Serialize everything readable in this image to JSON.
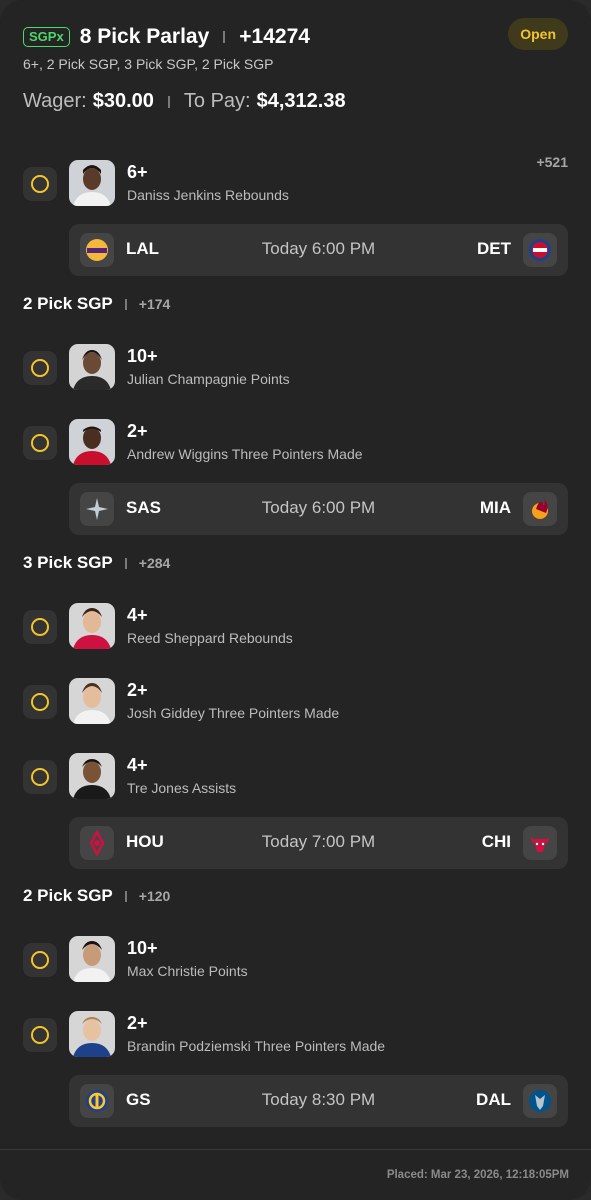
{
  "header": {
    "badge": "SGPx",
    "title": "8 Pick Parlay",
    "odds": "+14274",
    "subtitle": "6+, 2 Pick SGP, 3 Pick SGP, 2 Pick SGP",
    "status": "Open"
  },
  "wager": {
    "wager_label": "Wager:",
    "wager_value": "$30.00",
    "pay_label": "To Pay:",
    "pay_value": "$4,312.38"
  },
  "legs": [
    {
      "line": "6+",
      "desc": "Daniss Jenkins Rebounds",
      "odds": "+521"
    },
    {
      "line": "10+",
      "desc": "Julian Champagnie Points"
    },
    {
      "line": "2+",
      "desc": "Andrew Wiggins Three Pointers Made"
    },
    {
      "line": "4+",
      "desc": "Reed Sheppard Rebounds"
    },
    {
      "line": "2+",
      "desc": "Josh Giddey Three Pointers Made"
    },
    {
      "line": "4+",
      "desc": "Tre Jones Assists"
    },
    {
      "line": "10+",
      "desc": "Max Christie Points"
    },
    {
      "line": "2+",
      "desc": "Brandin Podziemski Three Pointers Made"
    }
  ],
  "groups": [
    {
      "title": "2 Pick SGP",
      "odds": "+174"
    },
    {
      "title": "3 Pick SGP",
      "odds": "+284"
    },
    {
      "title": "2 Pick SGP",
      "odds": "+120"
    }
  ],
  "games": [
    {
      "away": "LAL",
      "home": "DET",
      "time": "Today 6:00 PM",
      "away_icon": "lakers-logo-icon",
      "home_icon": "pistons-logo-icon"
    },
    {
      "away": "SAS",
      "home": "MIA",
      "time": "Today 6:00 PM",
      "away_icon": "spurs-logo-icon",
      "home_icon": "heat-logo-icon"
    },
    {
      "away": "HOU",
      "home": "CHI",
      "time": "Today 7:00 PM",
      "away_icon": "rockets-logo-icon",
      "home_icon": "bulls-logo-icon"
    },
    {
      "away": "GS",
      "home": "DAL",
      "time": "Today 8:30 PM",
      "away_icon": "warriors-logo-icon",
      "home_icon": "mavericks-logo-icon"
    }
  ],
  "footer": {
    "placed": "Placed: Mar 23, 2026, 12:18:05PM"
  },
  "colors": {
    "accent_yellow": "#f3c42c",
    "sgpx_green": "#4bd96b",
    "background": "#242424"
  }
}
